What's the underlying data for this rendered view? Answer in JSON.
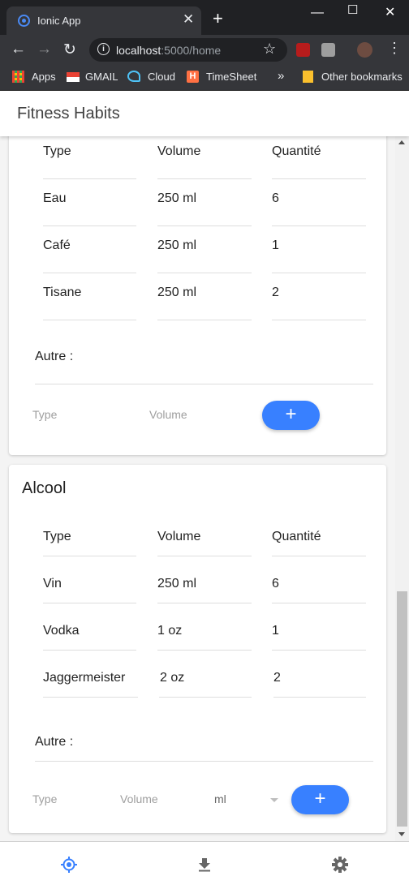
{
  "browser": {
    "tab_title": "Ionic App",
    "tab_close": "✕",
    "new_tab": "+",
    "url_host": "localhost",
    "url_rest": ":5000/home",
    "bookmarks": [
      {
        "label": "Apps"
      },
      {
        "label": "GMAIL"
      },
      {
        "label": "Cloud"
      },
      {
        "label": "TimeSheet"
      },
      {
        "label": "Other bookmarks"
      }
    ],
    "more_bookmarks": "»"
  },
  "app": {
    "title": "Fitness Habits"
  },
  "card1": {
    "headers": [
      "Type",
      "Volume",
      "Quantité"
    ],
    "rows": [
      [
        "Eau",
        "250 ml",
        "6"
      ],
      [
        "Café",
        "250 ml",
        "1"
      ],
      [
        "Tisane",
        "250 ml",
        "2"
      ]
    ],
    "other_label": "Autre :",
    "type_placeholder": "Type",
    "volume_placeholder": "Volume",
    "add_label": "+"
  },
  "card2": {
    "title": "Alcool",
    "headers": [
      "Type",
      "Volume",
      "Quantité"
    ],
    "rows": [
      [
        "Vin",
        "250 ml",
        "6"
      ],
      [
        "Vodka",
        "1 oz",
        "1"
      ],
      [
        "Jaggermeister",
        "2 oz",
        "2"
      ]
    ],
    "other_label": "Autre :",
    "type_placeholder": "Type",
    "volume_placeholder": "Volume",
    "unit_value": "ml",
    "add_label": "+"
  },
  "tabs": [
    {
      "icon": "locate-icon",
      "active": true
    },
    {
      "icon": "download-icon",
      "active": false
    },
    {
      "icon": "settings-gear-icon",
      "active": false
    }
  ],
  "colors": {
    "primary": "#3880ff",
    "chrome_dark": "#202124",
    "chrome_toolbar": "#35363a"
  }
}
